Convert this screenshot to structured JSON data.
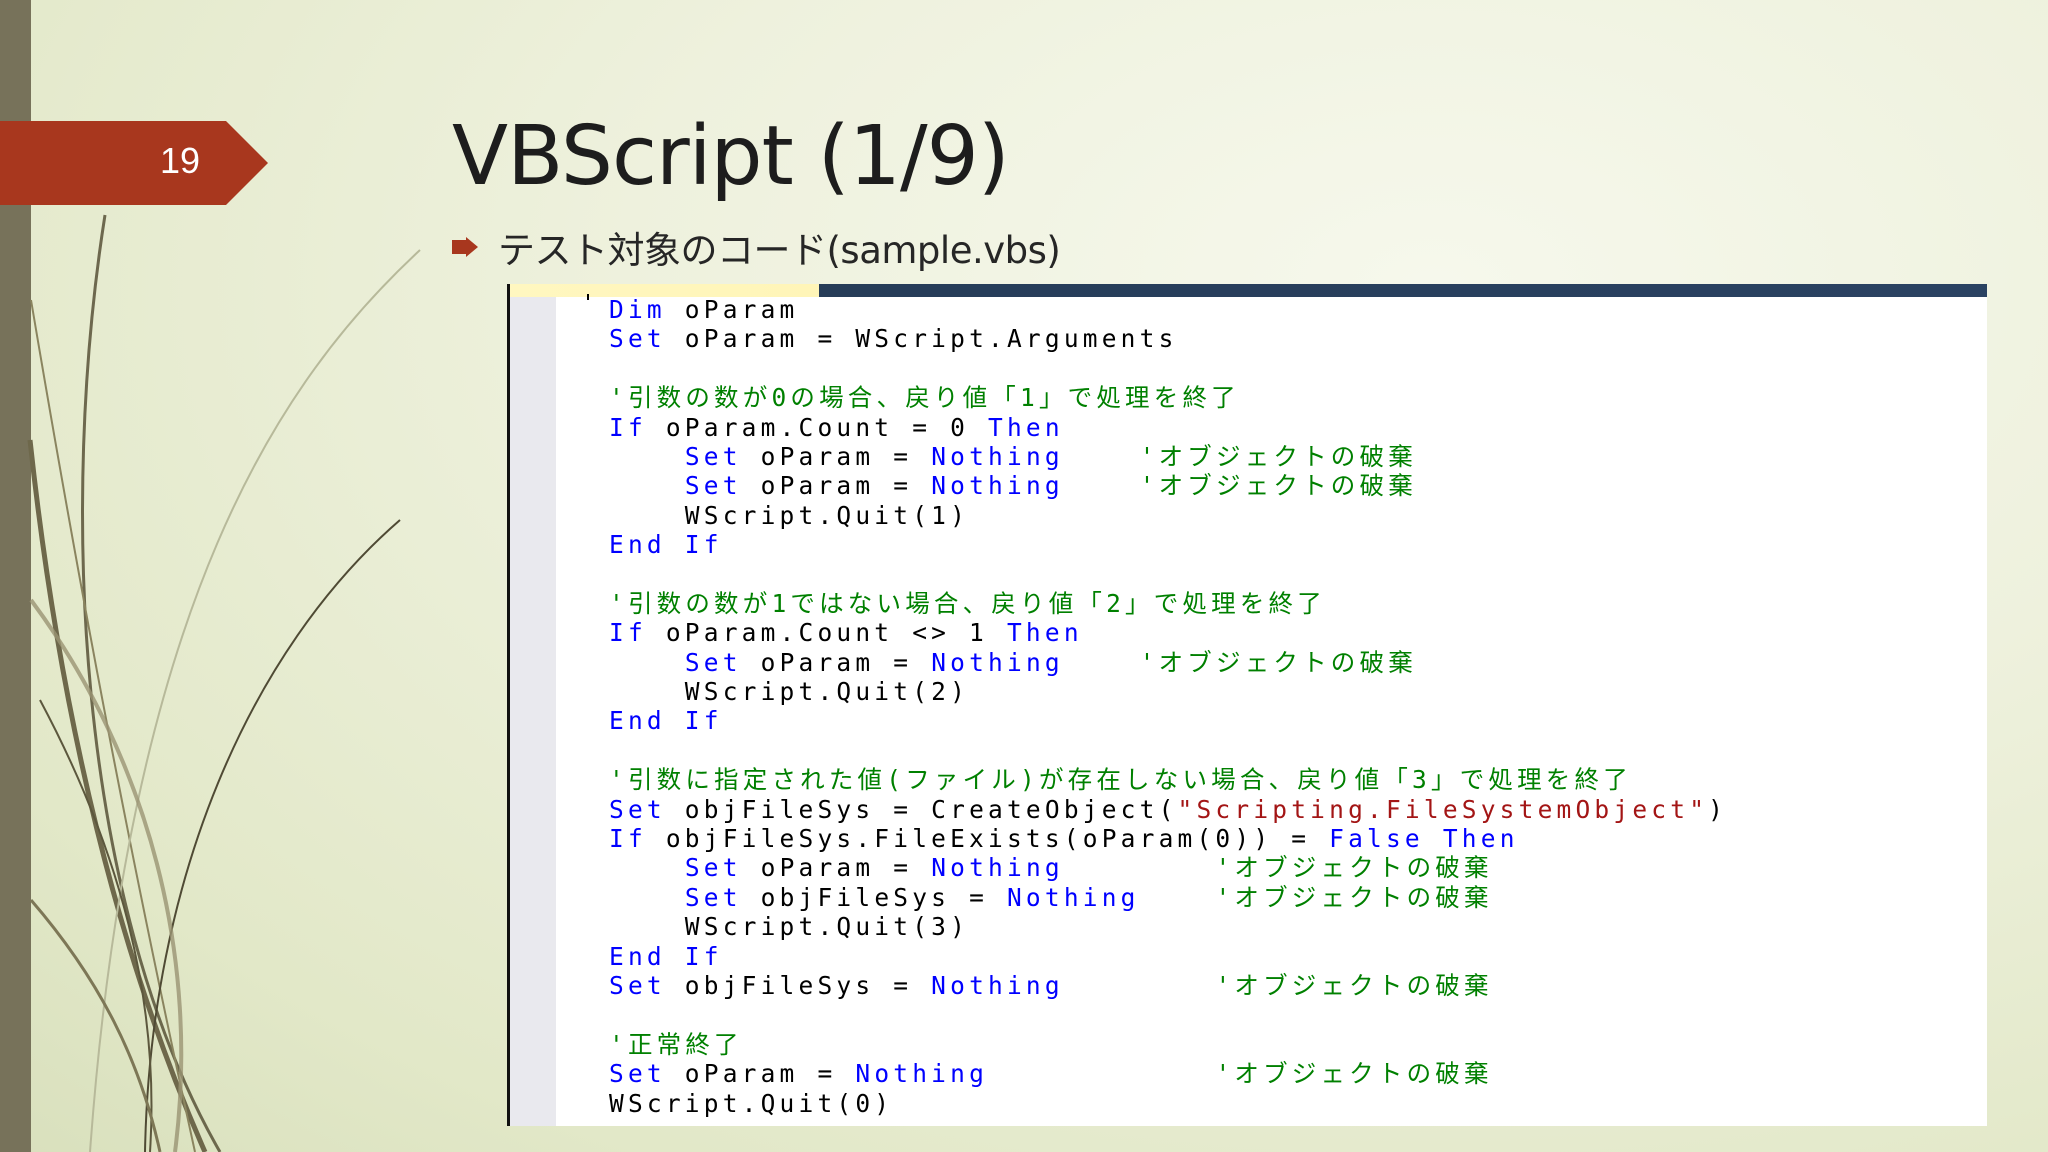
{
  "slide": {
    "page_number": "19",
    "title": "VBScript (1/9)",
    "bullet_text": "テスト対象のコード(sample.vbs)",
    "accent_color": "#a8371e",
    "sidebar_color": "#77725a",
    "bullet_icon": "arrow-right-icon"
  },
  "code": {
    "language": "VBScript",
    "colors": {
      "keyword": "#0000ff",
      "comment": "#008000",
      "string": "#a31515",
      "text": "#000000"
    },
    "lines": [
      [
        {
          "k": "kw",
          "t": "Dim"
        },
        {
          "k": "tx",
          "t": " oParam"
        }
      ],
      [
        {
          "k": "kw",
          "t": "Set"
        },
        {
          "k": "tx",
          "t": " oParam = WScript.Arguments"
        }
      ],
      [],
      [
        {
          "k": "cm",
          "t": "'引数の数が0の場合、戻り値「1」で処理を終了"
        }
      ],
      [
        {
          "k": "kw",
          "t": "If"
        },
        {
          "k": "tx",
          "t": " oParam.Count = 0 "
        },
        {
          "k": "kw",
          "t": "Then"
        }
      ],
      [
        {
          "k": "tx",
          "t": "    "
        },
        {
          "k": "kw",
          "t": "Set"
        },
        {
          "k": "tx",
          "t": " oParam = "
        },
        {
          "k": "kw",
          "t": "Nothing"
        },
        {
          "k": "tx",
          "t": "    "
        },
        {
          "k": "cm",
          "t": "'オブジェクトの破棄"
        }
      ],
      [
        {
          "k": "tx",
          "t": "    "
        },
        {
          "k": "kw",
          "t": "Set"
        },
        {
          "k": "tx",
          "t": " oParam = "
        },
        {
          "k": "kw",
          "t": "Nothing"
        },
        {
          "k": "tx",
          "t": "    "
        },
        {
          "k": "cm",
          "t": "'オブジェクトの破棄"
        }
      ],
      [
        {
          "k": "tx",
          "t": "    WScript.Quit(1)"
        }
      ],
      [
        {
          "k": "kw",
          "t": "End If"
        }
      ],
      [],
      [
        {
          "k": "cm",
          "t": "'引数の数が1ではない場合、戻り値「2」で処理を終了"
        }
      ],
      [
        {
          "k": "kw",
          "t": "If"
        },
        {
          "k": "tx",
          "t": " oParam.Count <> 1 "
        },
        {
          "k": "kw",
          "t": "Then"
        }
      ],
      [
        {
          "k": "tx",
          "t": "    "
        },
        {
          "k": "kw",
          "t": "Set"
        },
        {
          "k": "tx",
          "t": " oParam = "
        },
        {
          "k": "kw",
          "t": "Nothing"
        },
        {
          "k": "tx",
          "t": "    "
        },
        {
          "k": "cm",
          "t": "'オブジェクトの破棄"
        }
      ],
      [
        {
          "k": "tx",
          "t": "    WScript.Quit(2)"
        }
      ],
      [
        {
          "k": "kw",
          "t": "End If"
        }
      ],
      [],
      [
        {
          "k": "cm",
          "t": "'引数に指定された値(ファイル)が存在しない場合、戻り値「3」で処理を終了"
        }
      ],
      [
        {
          "k": "kw",
          "t": "Set"
        },
        {
          "k": "tx",
          "t": " objFileSys = CreateObject("
        },
        {
          "k": "st",
          "t": "\"Scripting.FileSystemObject\""
        },
        {
          "k": "tx",
          "t": ")"
        }
      ],
      [
        {
          "k": "kw",
          "t": "If"
        },
        {
          "k": "tx",
          "t": " objFileSys.FileExists(oParam(0)) = "
        },
        {
          "k": "kw",
          "t": "False"
        },
        {
          "k": "tx",
          "t": " "
        },
        {
          "k": "kw",
          "t": "Then"
        }
      ],
      [
        {
          "k": "tx",
          "t": "    "
        },
        {
          "k": "kw",
          "t": "Set"
        },
        {
          "k": "tx",
          "t": " oParam = "
        },
        {
          "k": "kw",
          "t": "Nothing"
        },
        {
          "k": "tx",
          "t": "        "
        },
        {
          "k": "cm",
          "t": "'オブジェクトの破棄"
        }
      ],
      [
        {
          "k": "tx",
          "t": "    "
        },
        {
          "k": "kw",
          "t": "Set"
        },
        {
          "k": "tx",
          "t": " objFileSys = "
        },
        {
          "k": "kw",
          "t": "Nothing"
        },
        {
          "k": "tx",
          "t": "    "
        },
        {
          "k": "cm",
          "t": "'オブジェクトの破棄"
        }
      ],
      [
        {
          "k": "tx",
          "t": "    WScript.Quit(3)"
        }
      ],
      [
        {
          "k": "kw",
          "t": "End If"
        }
      ],
      [
        {
          "k": "kw",
          "t": "Set"
        },
        {
          "k": "tx",
          "t": " objFileSys = "
        },
        {
          "k": "kw",
          "t": "Nothing"
        },
        {
          "k": "tx",
          "t": "        "
        },
        {
          "k": "cm",
          "t": "'オブジェクトの破棄"
        }
      ],
      [],
      [
        {
          "k": "cm",
          "t": "'正常終了"
        }
      ],
      [
        {
          "k": "kw",
          "t": "Set"
        },
        {
          "k": "tx",
          "t": " oParam = "
        },
        {
          "k": "kw",
          "t": "Nothing"
        },
        {
          "k": "tx",
          "t": "            "
        },
        {
          "k": "cm",
          "t": "'オブジェクトの破棄"
        }
      ],
      [
        {
          "k": "tx",
          "t": "WScript.Quit(0)"
        }
      ]
    ]
  }
}
